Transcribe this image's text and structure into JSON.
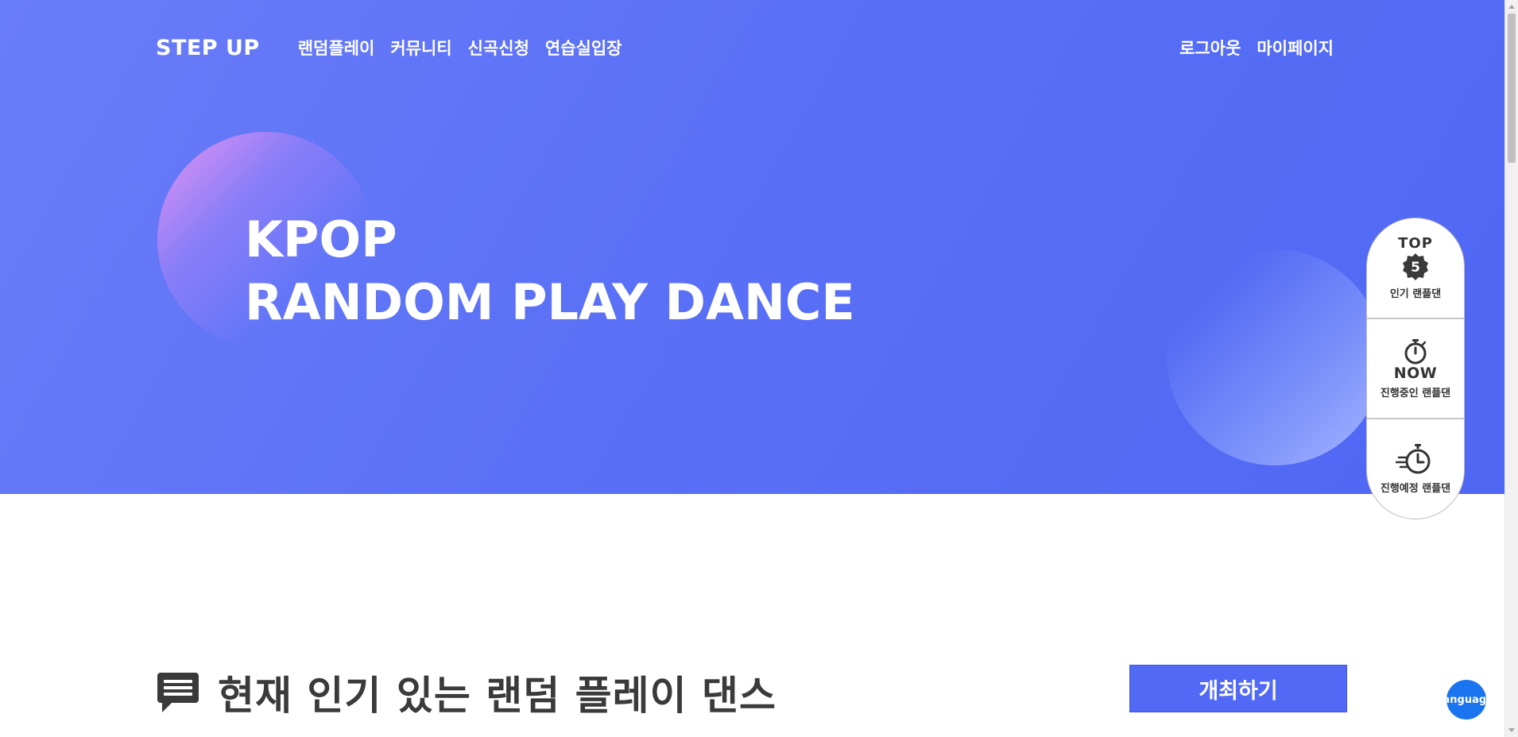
{
  "header": {
    "logo": "STEP UP",
    "menu": [
      {
        "label": "랜덤플레이"
      },
      {
        "label": "커뮤니티"
      },
      {
        "label": "신곡신청"
      },
      {
        "label": "연습실입장"
      }
    ],
    "right_links": [
      {
        "label": "로그아웃"
      },
      {
        "label": "마이페이지"
      }
    ]
  },
  "hero": {
    "title_line1": "KPOP",
    "title_line2": "RANDOM PLAY DANCE"
  },
  "quick_panel": {
    "items": [
      {
        "top_text": "TOP",
        "badge": "5",
        "label": "인기 랜플댄",
        "icon": "top5-badge-icon"
      },
      {
        "top_text": "NOW",
        "label": "진행중인 랜플댄",
        "icon": "stopwatch-icon"
      },
      {
        "label": "진행예정 랜플댄",
        "icon": "fast-clock-icon"
      }
    ]
  },
  "section": {
    "icon": "chat-bubble-icon",
    "title": "현재 인기 있는 랜덤 플레이 댄스",
    "host_button": "개최하기"
  },
  "language_button": "language",
  "colors": {
    "hero_bg": "#5a70f6",
    "accent": "#5269f5",
    "language_bg": "#1a74f0",
    "text_dark": "#3a3a3a"
  }
}
